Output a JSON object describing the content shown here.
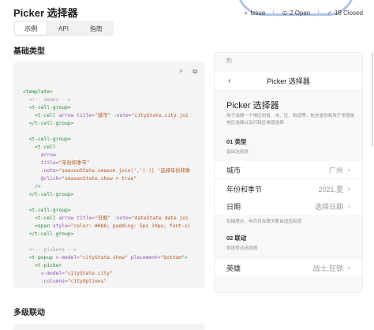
{
  "page": {
    "title": "Picker 选择器"
  },
  "issues": {
    "issue_label": "Issue",
    "open_label": "2 Open",
    "closed_label": "18 Closed",
    "icons": [
      "plus-icon",
      "open-issue-icon",
      "check-circle-icon"
    ]
  },
  "tabs": [
    {
      "label": "示例",
      "active": true
    },
    {
      "label": "API",
      "active": false
    },
    {
      "label": "指南",
      "active": false
    }
  ],
  "sections": {
    "basic": "基础类型",
    "cascade": "多级联动"
  },
  "code": {
    "toolbar_icons": [
      "lightning-icon",
      "copy-icon"
    ],
    "lines": [
      {
        "parts": [
          [
            "tag",
            "<template>"
          ]
        ]
      },
      {
        "parts": [
          [
            "plain",
            "  "
          ],
          [
            "cmt",
            "<!-- demos -->"
          ]
        ]
      },
      {
        "parts": [
          [
            "plain",
            "  "
          ],
          [
            "tag",
            "<t-cell-group>"
          ]
        ]
      },
      {
        "parts": [
          [
            "plain",
            "    "
          ],
          [
            "tag",
            "<t-cell "
          ],
          [
            "attr",
            "arrow title="
          ],
          [
            "str",
            "\"城市\""
          ],
          [
            "attr",
            " :note="
          ],
          [
            "str",
            "\"cityState.city.joi"
          ]
        ]
      },
      {
        "parts": [
          [
            "plain",
            "  "
          ],
          [
            "tag",
            "</t-cell-group>"
          ]
        ]
      },
      {
        "parts": [
          [
            "plain",
            ""
          ]
        ]
      },
      {
        "parts": [
          [
            "plain",
            "  "
          ],
          [
            "tag",
            "<t-cell-group>"
          ]
        ]
      },
      {
        "parts": [
          [
            "plain",
            "    "
          ],
          [
            "tag",
            "<t-cell"
          ]
        ]
      },
      {
        "parts": [
          [
            "plain",
            "      "
          ],
          [
            "attr",
            "arrow"
          ]
        ]
      },
      {
        "parts": [
          [
            "plain",
            "      "
          ],
          [
            "attr",
            "title="
          ],
          [
            "str",
            "\"年份和季节\""
          ]
        ]
      },
      {
        "parts": [
          [
            "plain",
            "      "
          ],
          [
            "attr",
            ":note="
          ],
          [
            "str",
            "\"seasonState.season.join(',') || '选择年份和季"
          ]
        ]
      },
      {
        "parts": [
          [
            "plain",
            "      "
          ],
          [
            "attr",
            "@click="
          ],
          [
            "str",
            "\"seasonState.show = true\""
          ]
        ]
      },
      {
        "parts": [
          [
            "plain",
            "    "
          ],
          [
            "tag",
            "/>"
          ]
        ]
      },
      {
        "parts": [
          [
            "plain",
            "  "
          ],
          [
            "tag",
            "</t-cell-group>"
          ]
        ]
      },
      {
        "parts": [
          [
            "plain",
            ""
          ]
        ]
      },
      {
        "parts": [
          [
            "plain",
            "  "
          ],
          [
            "tag",
            "<t-cell-group>"
          ]
        ]
      },
      {
        "parts": [
          [
            "plain",
            "    "
          ],
          [
            "tag",
            "<t-cell "
          ],
          [
            "attr",
            "arrow title="
          ],
          [
            "str",
            "\"日期\""
          ],
          [
            "attr",
            " :note="
          ],
          [
            "str",
            "\"dateState.date.joi"
          ]
        ]
      },
      {
        "parts": [
          [
            "plain",
            "    "
          ],
          [
            "tag",
            "<span "
          ],
          [
            "attr",
            "style="
          ],
          [
            "str",
            "\"color: #888; padding: 5px 10px; font-si"
          ]
        ]
      },
      {
        "parts": [
          [
            "plain",
            "  "
          ],
          [
            "tag",
            "</t-cell-group>"
          ]
        ]
      },
      {
        "parts": [
          [
            "plain",
            ""
          ]
        ]
      },
      {
        "parts": [
          [
            "plain",
            "  "
          ],
          [
            "cmt",
            "<!-- pickers -->"
          ]
        ]
      },
      {
        "parts": [
          [
            "plain",
            "  "
          ],
          [
            "tag",
            "<t-popup "
          ],
          [
            "attr",
            "v-model="
          ],
          [
            "str",
            "\"cityState.show\""
          ],
          [
            "attr",
            " placement="
          ],
          [
            "str",
            "\"bottom\""
          ],
          [
            "tag",
            ">"
          ]
        ]
      },
      {
        "parts": [
          [
            "plain",
            "    "
          ],
          [
            "tag",
            "<t-picker"
          ]
        ]
      },
      {
        "parts": [
          [
            "plain",
            "      "
          ],
          [
            "attr",
            "v-model="
          ],
          [
            "str",
            "\"cityState.city\""
          ]
        ]
      },
      {
        "parts": [
          [
            "plain",
            "      "
          ],
          [
            "attr",
            ":columns="
          ],
          [
            "str",
            "\"cityOptions\""
          ]
        ]
      }
    ]
  },
  "phone": {
    "top_icon": "酌",
    "nav_title": "Picker 选择器",
    "demo_title": "Picker 选择器",
    "demo_desc": "用于选择一个地区的省、市、区、街道等，包含省份和用于多层级地区选择以及行政区单层选择",
    "block1": {
      "title": "01 类型",
      "desc": "基础选择器"
    },
    "cells": [
      {
        "label": "城市",
        "value": "广州"
      },
      {
        "label": "年份和季节",
        "value": "2021,夏"
      },
      {
        "label": "日期",
        "value": "选择日期"
      }
    ],
    "hint": "仅抽屉示、年月日关联天数自适应实现",
    "block2": {
      "title": "02 联动",
      "desc": "数据联动选择器"
    },
    "cascade_cell": {
      "label": "英雄",
      "value": "战士,狂铁"
    }
  }
}
